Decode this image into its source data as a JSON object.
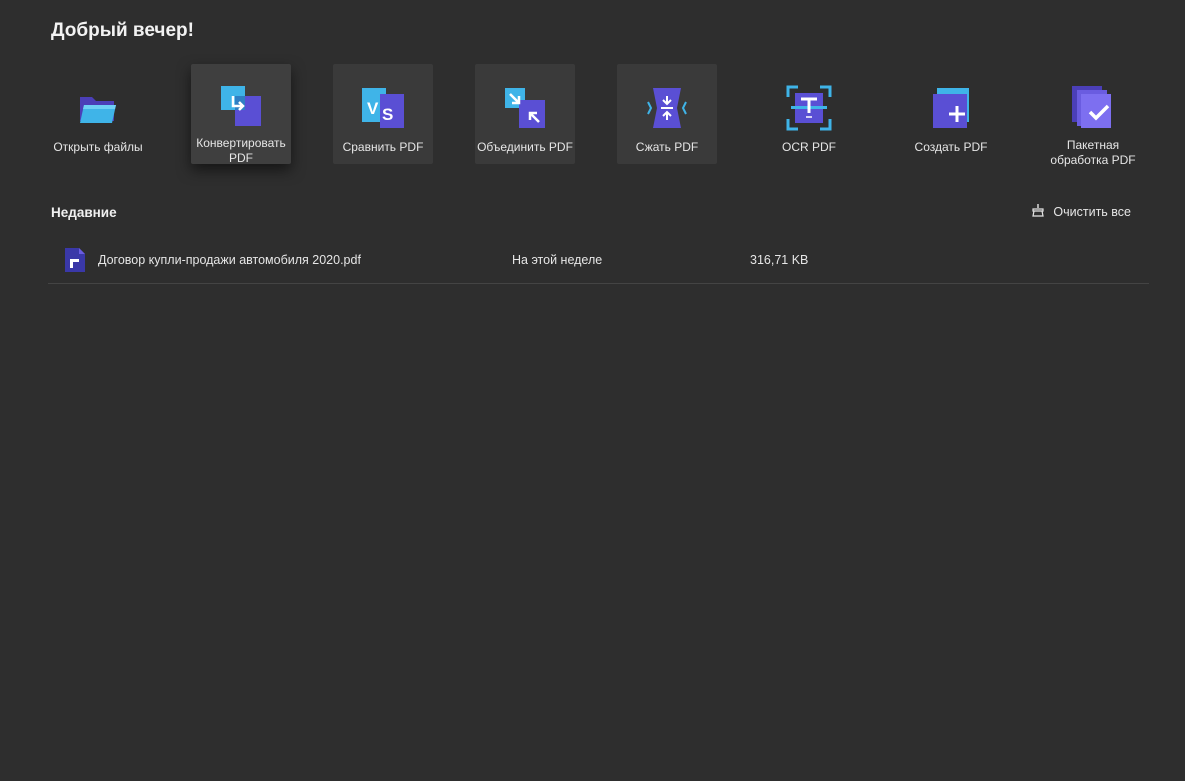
{
  "header": {
    "greeting": "Добрый вечер!"
  },
  "tools": [
    {
      "label": "Открыть файлы",
      "icon": "open-folder-icon"
    },
    {
      "label": "Конвертировать PDF",
      "icon": "convert-icon"
    },
    {
      "label": "Сравнить PDF",
      "icon": "compare-icon"
    },
    {
      "label": "Объединить PDF",
      "icon": "combine-icon"
    },
    {
      "label": "Сжать PDF",
      "icon": "compress-icon"
    },
    {
      "label": "OCR PDF",
      "icon": "ocr-icon"
    },
    {
      "label": "Создать PDF",
      "icon": "create-icon"
    },
    {
      "label": "Пакетная обработка PDF",
      "icon": "batch-icon"
    }
  ],
  "recent": {
    "title": "Недавние",
    "clear_label": "Очистить все",
    "files": [
      {
        "name": "Договор купли-продажи автомобиля 2020.pdf",
        "date": "На этой неделе",
        "size": "316,71 KB"
      }
    ]
  },
  "colors": {
    "background": "#2e2e2e",
    "accent_purple": "#6a5ce0",
    "accent_blue": "#3fb4e8"
  }
}
